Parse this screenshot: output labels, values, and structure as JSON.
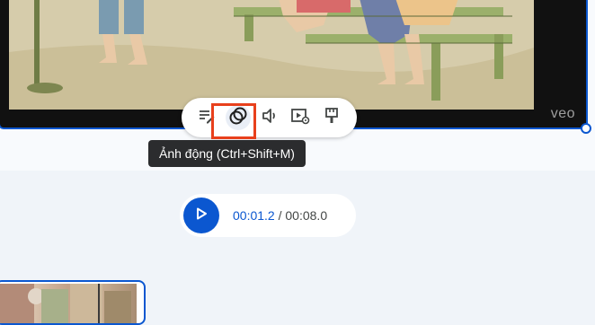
{
  "preview": {
    "watermark": "veo"
  },
  "toolbar": {
    "buttons": [
      {
        "name": "edit-text",
        "icon": "edit-prompt-icon"
      },
      {
        "name": "animate",
        "icon": "overlap-circles-icon",
        "active": true
      },
      {
        "name": "audio",
        "icon": "speaker-icon"
      },
      {
        "name": "video-settings",
        "icon": "video-gear-icon"
      },
      {
        "name": "style",
        "icon": "paintbrush-icon"
      }
    ],
    "highlight_color": "#e8401c"
  },
  "tooltip": {
    "text": "Ảnh động (Ctrl+Shift+M)"
  },
  "player": {
    "current_time": "00:01.2",
    "separator": " / ",
    "total_time": "00:08.0"
  },
  "colors": {
    "accent": "#0b57d0",
    "background": "#f0f4f9",
    "tooltip_bg": "#2b2c2e"
  }
}
